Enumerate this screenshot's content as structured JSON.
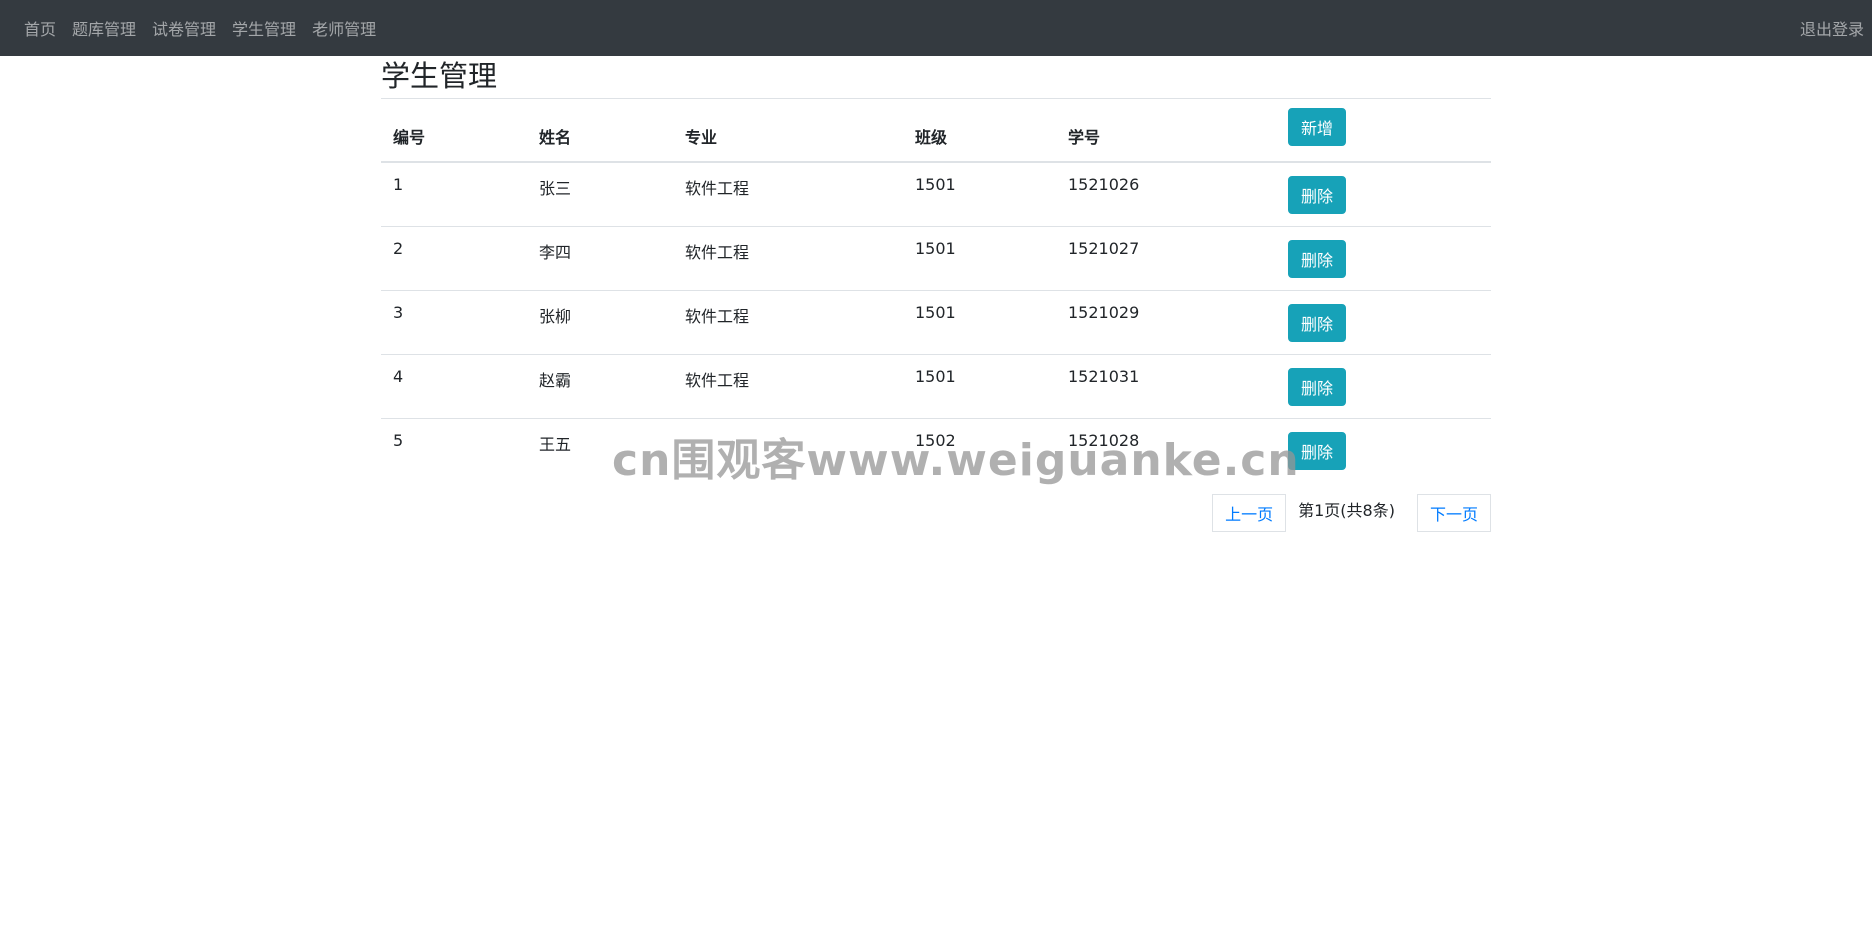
{
  "nav": {
    "items": [
      {
        "label": "首页"
      },
      {
        "label": "题库管理"
      },
      {
        "label": "试卷管理"
      },
      {
        "label": "学生管理"
      },
      {
        "label": "老师管理"
      }
    ],
    "logout": "退出登录"
  },
  "page": {
    "title": "学生管理"
  },
  "table": {
    "headers": {
      "id": "编号",
      "name": "姓名",
      "major": "专业",
      "class": "班级",
      "student_no": "学号"
    },
    "add_label": "新增",
    "delete_label": "删除",
    "rows": [
      {
        "id": "1",
        "name": "张三",
        "major": "软件工程",
        "class": "1501",
        "student_no": "1521026"
      },
      {
        "id": "2",
        "name": "李四",
        "major": "软件工程",
        "class": "1501",
        "student_no": "1521027"
      },
      {
        "id": "3",
        "name": "张柳",
        "major": "软件工程",
        "class": "1501",
        "student_no": "1521029"
      },
      {
        "id": "4",
        "name": "赵霸",
        "major": "软件工程",
        "class": "1501",
        "student_no": "1521031"
      },
      {
        "id": "5",
        "name": "王五",
        "major": "",
        "class": "1502",
        "student_no": "1521028"
      }
    ]
  },
  "pager": {
    "prev": "上一页",
    "info": "第1页(共8条)",
    "next": "下一页"
  },
  "watermark": "cn围观客www.weiguanke.cn",
  "colors": {
    "navbar": "#343a40",
    "accent": "#17a2b8",
    "link": "#007bff"
  }
}
